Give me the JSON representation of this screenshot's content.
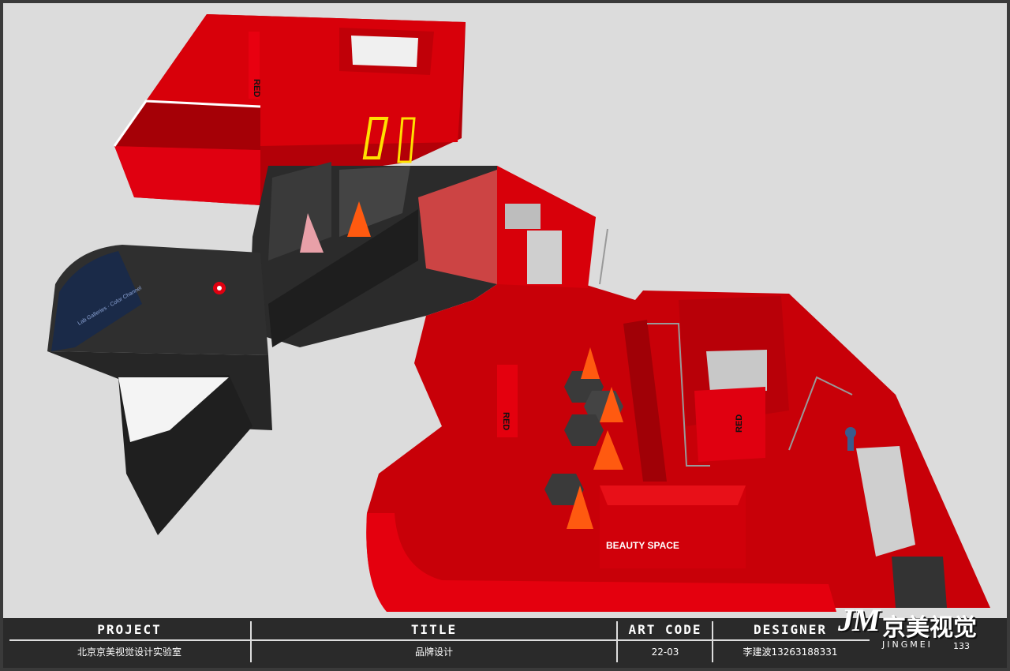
{
  "scene": {
    "red_sign_labels": [
      "RED",
      "RED",
      "RED"
    ],
    "beauty_sign": "BEAUTY SPACE",
    "wall_text": "Lab Galleries · Color Channel"
  },
  "title_block": {
    "headers": {
      "project": "PROJECT",
      "title": "TITLE",
      "art_code": "ART CODE",
      "designer": "DESIGNER"
    },
    "values": {
      "project": "北京京美视觉设计实验室",
      "title": "品牌设计",
      "art_code": "22-03",
      "designer": "李建波13263188331"
    },
    "page_number": "133"
  },
  "logo": {
    "mark": "JM",
    "chinese": "京美视觉",
    "english": "JINGMEI"
  },
  "colors": {
    "wall_red": "#d8000a",
    "floor_red": "#c80008",
    "dark_grey": "#2b2b2b",
    "background": "#dcdcdc"
  }
}
